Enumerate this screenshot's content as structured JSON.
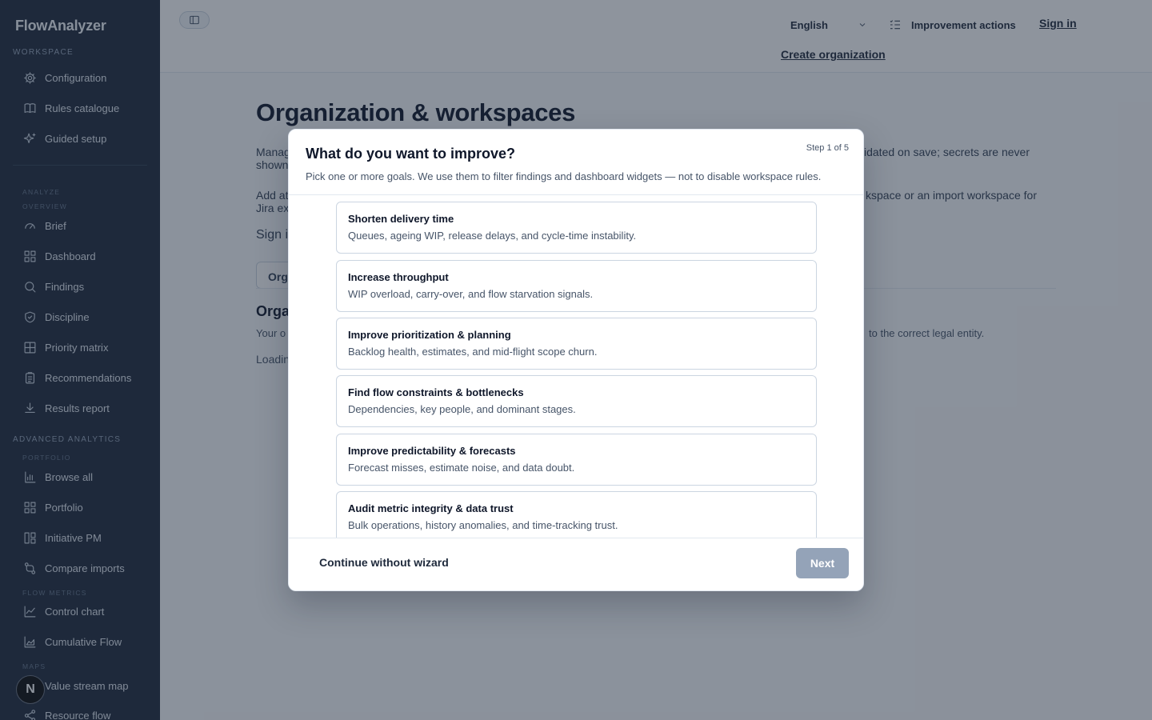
{
  "app": {
    "name": "FlowAnalyzer"
  },
  "sidebar": {
    "workspace_label": "WORKSPACE",
    "workspace_items": [
      {
        "label": "Configuration",
        "icon": "gear-icon"
      },
      {
        "label": "Rules catalogue",
        "icon": "book-icon"
      },
      {
        "label": "Guided setup",
        "icon": "sparkle-icon"
      }
    ],
    "analyze_label": "ANALYZE",
    "overview_label": "OVERVIEW",
    "analyze_items": [
      {
        "label": "Brief",
        "icon": "gauge-icon"
      },
      {
        "label": "Dashboard",
        "icon": "dashboard-icon"
      },
      {
        "label": "Findings",
        "icon": "search-icon"
      },
      {
        "label": "Discipline",
        "icon": "shield-icon"
      },
      {
        "label": "Priority matrix",
        "icon": "grid-icon"
      },
      {
        "label": "Recommendations",
        "icon": "clipboard-icon"
      },
      {
        "label": "Results report",
        "icon": "download-icon"
      }
    ],
    "advanced_label": "ADVANCED ANALYTICS",
    "portfolio_label": "PORTFOLIO",
    "portfolio_items": [
      {
        "label": "Browse all",
        "icon": "bar-chart-icon"
      },
      {
        "label": "Portfolio",
        "icon": "dashboard-icon"
      },
      {
        "label": "Initiative PM",
        "icon": "columns-icon"
      },
      {
        "label": "Compare imports",
        "icon": "compare-icon"
      }
    ],
    "flow_label": "FLOW METRICS",
    "flow_items": [
      {
        "label": "Control chart",
        "icon": "line-chart-icon"
      },
      {
        "label": "Cumulative Flow",
        "icon": "area-chart-icon"
      }
    ],
    "maps_label": "MAPS",
    "maps_items": [
      {
        "label": "Value stream map",
        "icon": "map-icon"
      },
      {
        "label": "Resource flow",
        "icon": "share-icon"
      }
    ],
    "avatar_letter": "N"
  },
  "header": {
    "language": "English",
    "improvement_actions": "Improvement actions",
    "sign_in": "Sign in",
    "create_org": "Create organization"
  },
  "main": {
    "title": "Organization & workspaces",
    "para1_left": "Manag",
    "para1_left2": "shown",
    "para1_right": "idated on save; secrets are never",
    "para2_left": "Add at",
    "para2_left2": "Jira ex",
    "para2_right": "kspace or an import workspace for",
    "signin_partial": "Sign i",
    "tab_partial": "Org",
    "section_title_partial": "Orga",
    "body_left": "Your o",
    "body_right": "to the correct legal entity.",
    "loading_partial": "Loadin"
  },
  "modal": {
    "title": "What do you want to improve?",
    "step": "Step 1 of 5",
    "subtitle": "Pick one or more goals. We use them to filter findings and dashboard widgets — not to disable workspace rules.",
    "goals": [
      {
        "title": "Shorten delivery time",
        "desc": "Queues, ageing WIP, release delays, and cycle-time instability."
      },
      {
        "title": "Increase throughput",
        "desc": "WIP overload, carry-over, and flow starvation signals."
      },
      {
        "title": "Improve prioritization & planning",
        "desc": "Backlog health, estimates, and mid-flight scope churn."
      },
      {
        "title": "Find flow constraints & bottlenecks",
        "desc": "Dependencies, key people, and dominant stages."
      },
      {
        "title": "Improve predictability & forecasts",
        "desc": "Forecast misses, estimate noise, and data doubt."
      },
      {
        "title": "Audit metric integrity & data trust",
        "desc": "Bulk operations, history anomalies, and time-tracking trust."
      }
    ],
    "skip": "Continue without wizard",
    "next": "Next"
  }
}
